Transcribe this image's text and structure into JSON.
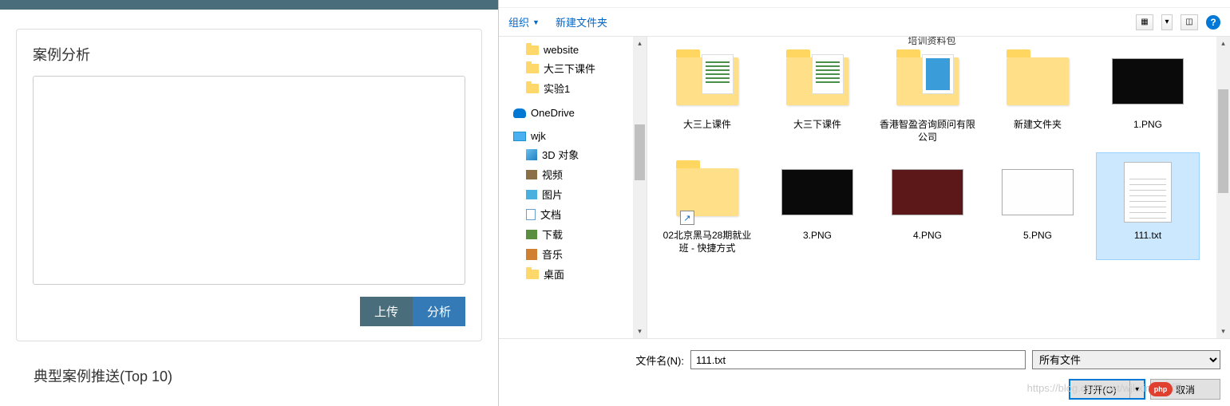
{
  "left": {
    "card_title": "案例分析",
    "upload": "上传",
    "analyze": "分析",
    "section_title": "典型案例推送(Top 10)"
  },
  "dialog": {
    "organize": "组织",
    "new_folder": "新建文件夹",
    "tree": {
      "website": "website",
      "folder2": "大三下课件",
      "folder3": "实验1",
      "onedrive": "OneDrive",
      "pc": "wjk",
      "obj3d": "3D 对象",
      "video": "视频",
      "pictures": "图片",
      "documents": "文档",
      "downloads": "下载",
      "music": "音乐",
      "desktop": "桌面"
    },
    "cut_header": "培训资料包",
    "files": [
      {
        "label": "大三上课件",
        "type": "folder-doc"
      },
      {
        "label": "大三下课件",
        "type": "folder-doc"
      },
      {
        "label": "香港智盈咨询顾问有限公司",
        "type": "folder-img"
      },
      {
        "label": "新建文件夹",
        "type": "folder"
      },
      {
        "label": "1.PNG",
        "type": "png-dark"
      },
      {
        "label": "02北京黑马28期就业班 - 快捷方式",
        "type": "folder-shortcut"
      },
      {
        "label": "3.PNG",
        "type": "png-dark"
      },
      {
        "label": "4.PNG",
        "type": "png-red"
      },
      {
        "label": "5.PNG",
        "type": "png-white"
      },
      {
        "label": "111.txt",
        "type": "txt",
        "selected": true
      }
    ],
    "filename_label": "文件名(N):",
    "filename_value": "111.txt",
    "filter": "所有文件",
    "open": "打开(O)",
    "cancel": "取消",
    "watermark": "https://blog.csdn.net/wjkxin中文网"
  }
}
